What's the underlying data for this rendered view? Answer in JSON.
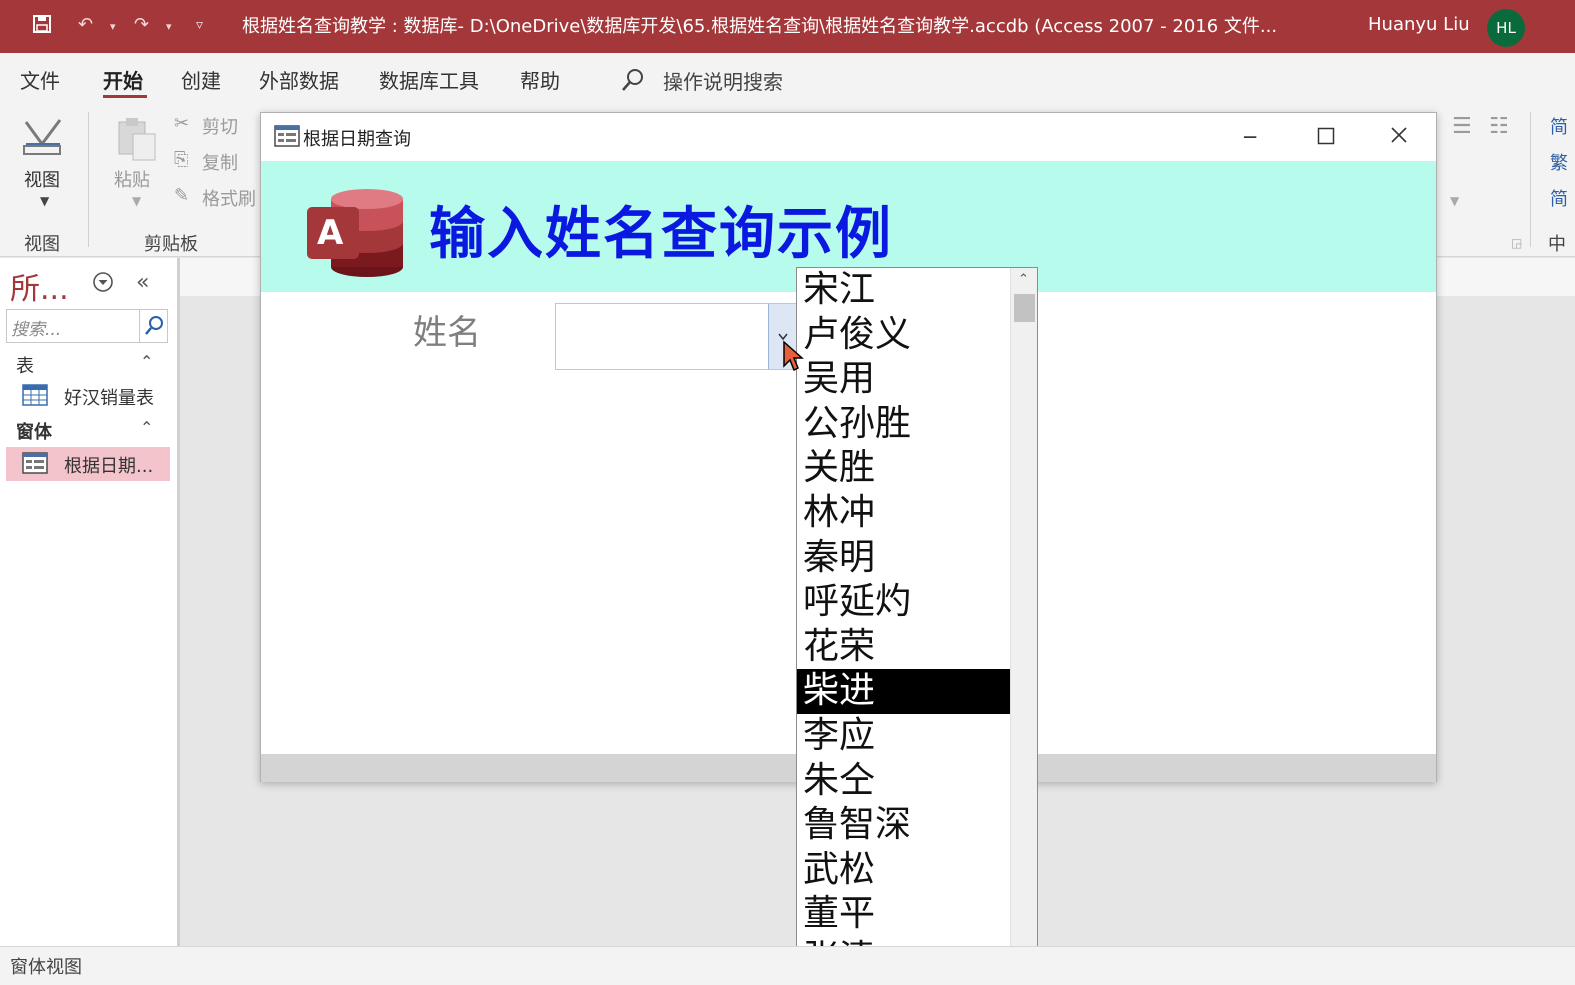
{
  "window": {
    "title": "根据姓名查询教学 : 数据库- D:\\OneDrive\\数据库开发\\65.根据姓名查询\\根据姓名查询教学.accdb (Access 2007 - 2016 文件...",
    "user_name": "Huanyu Liu",
    "user_initials": "HL"
  },
  "menu": {
    "tabs": [
      "文件",
      "开始",
      "创建",
      "外部数据",
      "数据库工具",
      "帮助"
    ],
    "active_tab": "开始",
    "tell_me": "操作说明搜索"
  },
  "ribbon": {
    "view_button": "视图",
    "view_group": "视图",
    "paste_button": "粘贴",
    "cut": "剪切",
    "copy": "复制",
    "format_painter": "格式刷",
    "clipboard_group": "剪贴板",
    "right_cmd_1": "简",
    "right_cmd_2": "繁",
    "right_cmd_3": "简",
    "right_group": "中"
  },
  "nav": {
    "title": "所...",
    "search_placeholder": "搜索...",
    "group_tables": "表",
    "table_item": "好汉销量表",
    "group_forms": "窗体",
    "form_item": "根据日期..."
  },
  "form": {
    "window_title": "根据日期查询",
    "logo_letter": "A",
    "heading": "输入姓名查询示例",
    "name_label": "姓名",
    "name_value": ""
  },
  "dropdown": {
    "options": [
      "宋江",
      "卢俊义",
      "吴用",
      "公孙胜",
      "关胜",
      "林冲",
      "秦明",
      "呼延灼",
      "花荣",
      "柴进",
      "李应",
      "朱仝",
      "鲁智深",
      "武松",
      "董平",
      "张清"
    ],
    "selected_index": 9
  },
  "status": {
    "text": "窗体视图"
  },
  "colors": {
    "accent": "#a4373a",
    "header_bg": "#b6fbec",
    "heading_text": "#0a18e0"
  }
}
